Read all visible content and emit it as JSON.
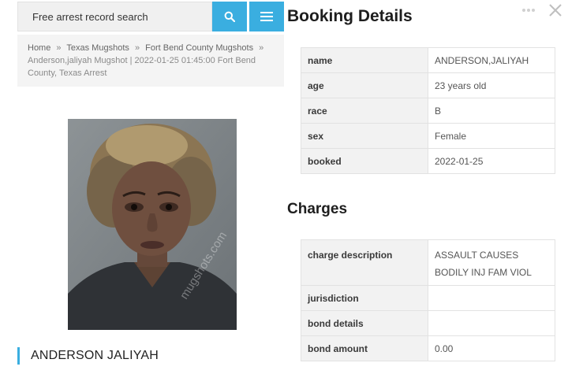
{
  "search": {
    "placeholder": "Free arrest record search",
    "search_icon": "search-icon",
    "menu_icon": "hamburger-menu-icon",
    "accent_color": "#3aaee0"
  },
  "breadcrumb": {
    "items": [
      "Home",
      "Texas Mugshots",
      "Fort Bend County Mugshots"
    ],
    "separator": "»",
    "current": "Anderson,jaliyah Mugshot | 2022-01-25 01:45:00 Fort Bend County, Texas Arrest"
  },
  "photo": {
    "watermark": "mugshots.com"
  },
  "person": {
    "name": "ANDERSON JALIYAH"
  },
  "booking": {
    "title": "Booking Details",
    "rows": [
      {
        "label": "name",
        "value": "ANDERSON,JALIYAH"
      },
      {
        "label": "age",
        "value": "23 years old"
      },
      {
        "label": "race",
        "value": "B"
      },
      {
        "label": "sex",
        "value": "Female"
      },
      {
        "label": "booked",
        "value": "2022-01-25"
      }
    ]
  },
  "charges": {
    "title": "Charges",
    "rows": [
      {
        "label": "charge description",
        "value": "ASSAULT CAUSES BODILY INJ FAM VIOL"
      },
      {
        "label": "jurisdiction",
        "value": ""
      },
      {
        "label": "bond details",
        "value": ""
      },
      {
        "label": "bond amount",
        "value": "0.00"
      }
    ]
  },
  "overlay": {
    "ad_icon": "ad-choices-icon",
    "close_icon": "close-icon"
  }
}
